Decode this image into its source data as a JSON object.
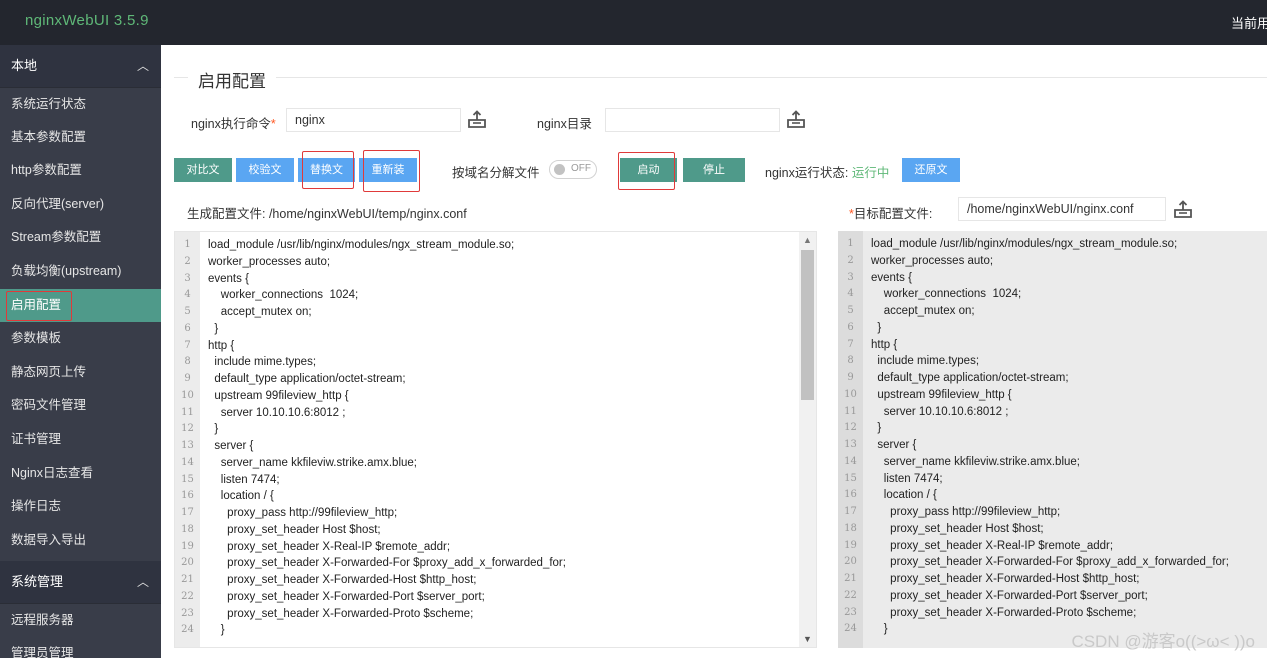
{
  "app": {
    "title": "nginxWebUI 3.5.9",
    "top_right": "当前用"
  },
  "sidebar": {
    "group_local": "本地",
    "items": [
      "系统运行状态",
      "基本参数配置",
      "http参数配置",
      "反向代理(server)",
      "Stream参数配置",
      "负载均衡(upstream)",
      "启用配置",
      "参数模板",
      "静态网页上传",
      "密码文件管理",
      "证书管理",
      "Nginx日志查看",
      "操作日志",
      "数据导入导出"
    ],
    "group_system": "系统管理",
    "system_items": [
      "远程服务器",
      "管理员管理"
    ]
  },
  "main": {
    "legend": "启用配置",
    "cmd_label": "nginx执行命令",
    "cmd_value": "nginx",
    "dir_label": "nginx目录",
    "dir_value": "",
    "buttons": {
      "compare": "对比文件",
      "check": "校验文件",
      "replace": "替换文件",
      "reload": "重新装载",
      "start": "启动nginx",
      "stop": "停止nginx",
      "restore": "还原文件"
    },
    "split_label": "按域名分解文件",
    "toggle_text": "OFF",
    "status_label": "nginx运行状态:",
    "status_value": "运行中",
    "gen_label": "生成配置文件: /home/nginxWebUI/temp/nginx.conf",
    "target_label": "目标配置文件:",
    "target_value": "/home/nginxWebUI/nginx.conf"
  },
  "code_lines": [
    "load_module /usr/lib/nginx/modules/ngx_stream_module.so;",
    "worker_processes auto;",
    "events {",
    "    worker_connections  1024;",
    "    accept_mutex on;",
    "  }",
    "http {",
    "  include mime.types;",
    "  default_type application/octet-stream;",
    "  upstream 99fileview_http {",
    "    server 10.10.10.6:8012 ;",
    "  }",
    "  server {",
    "    server_name kkfileviw.strike.amx.blue;",
    "    listen 7474;",
    "    location / {",
    "      proxy_pass http://99fileview_http;",
    "      proxy_set_header Host $host;",
    "      proxy_set_header X-Real-IP $remote_addr;",
    "      proxy_set_header X-Forwarded-For $proxy_add_x_forwarded_for;",
    "      proxy_set_header X-Forwarded-Host $http_host;",
    "      proxy_set_header X-Forwarded-Port $server_port;",
    "      proxy_set_header X-Forwarded-Proto $scheme;",
    "    }"
  ],
  "line_numbers": [
    "1",
    "2",
    "3",
    "4",
    "5",
    "6",
    "7",
    "8",
    "9",
    "10",
    "11",
    "12",
    "13",
    "14",
    "15",
    "16",
    "17",
    "18",
    "19",
    "20",
    "21",
    "22",
    "23",
    "24"
  ],
  "watermark": "CSDN @游客o((>ω< ))o",
  "colors": {
    "topbar": "#23262e",
    "sidebar": "#393d49",
    "accent_green": "#4f9a8a",
    "accent_blue": "#5aa6f2",
    "highlight_red": "#e03a3a"
  }
}
